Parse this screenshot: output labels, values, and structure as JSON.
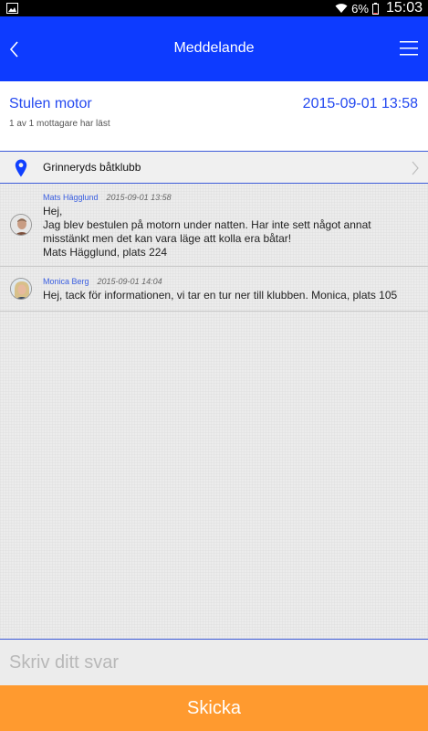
{
  "status_bar": {
    "battery": "6%",
    "time": "15:03"
  },
  "app_bar": {
    "title": "Meddelande"
  },
  "message": {
    "subject": "Stulen motor",
    "date": "2015-09-01 13:58",
    "read_status": "1 av 1 mottagare har läst"
  },
  "club": {
    "name": "Grinneryds båtklubb"
  },
  "conversation": [
    {
      "sender": "Mats Hägglund",
      "timestamp": "2015-09-01 13:58",
      "lines": [
        "Hej,",
        "Jag blev bestulen på motorn under natten. Har inte sett något annat",
        "misstänkt men det kan vara läge att kolla era båtar!",
        "Mats Hägglund, plats 224"
      ]
    },
    {
      "sender": "Monica Berg",
      "timestamp": "2015-09-01 14:04",
      "lines": [
        "Hej, tack för informationen, vi tar en tur ner till klubben. Monica, plats 105"
      ]
    }
  ],
  "reply": {
    "placeholder": "Skriv ditt svar",
    "value": ""
  },
  "send_button": {
    "label": "Skicka"
  },
  "colors": {
    "app_bar": "#0d3bff",
    "accent_text": "#2348f0",
    "send_button": "#ff9a2f"
  },
  "icons": {
    "back": "chevron-left-icon",
    "menu": "hamburger-menu-icon",
    "location": "location-pin-icon",
    "row_chevron": "chevron-right-icon"
  }
}
